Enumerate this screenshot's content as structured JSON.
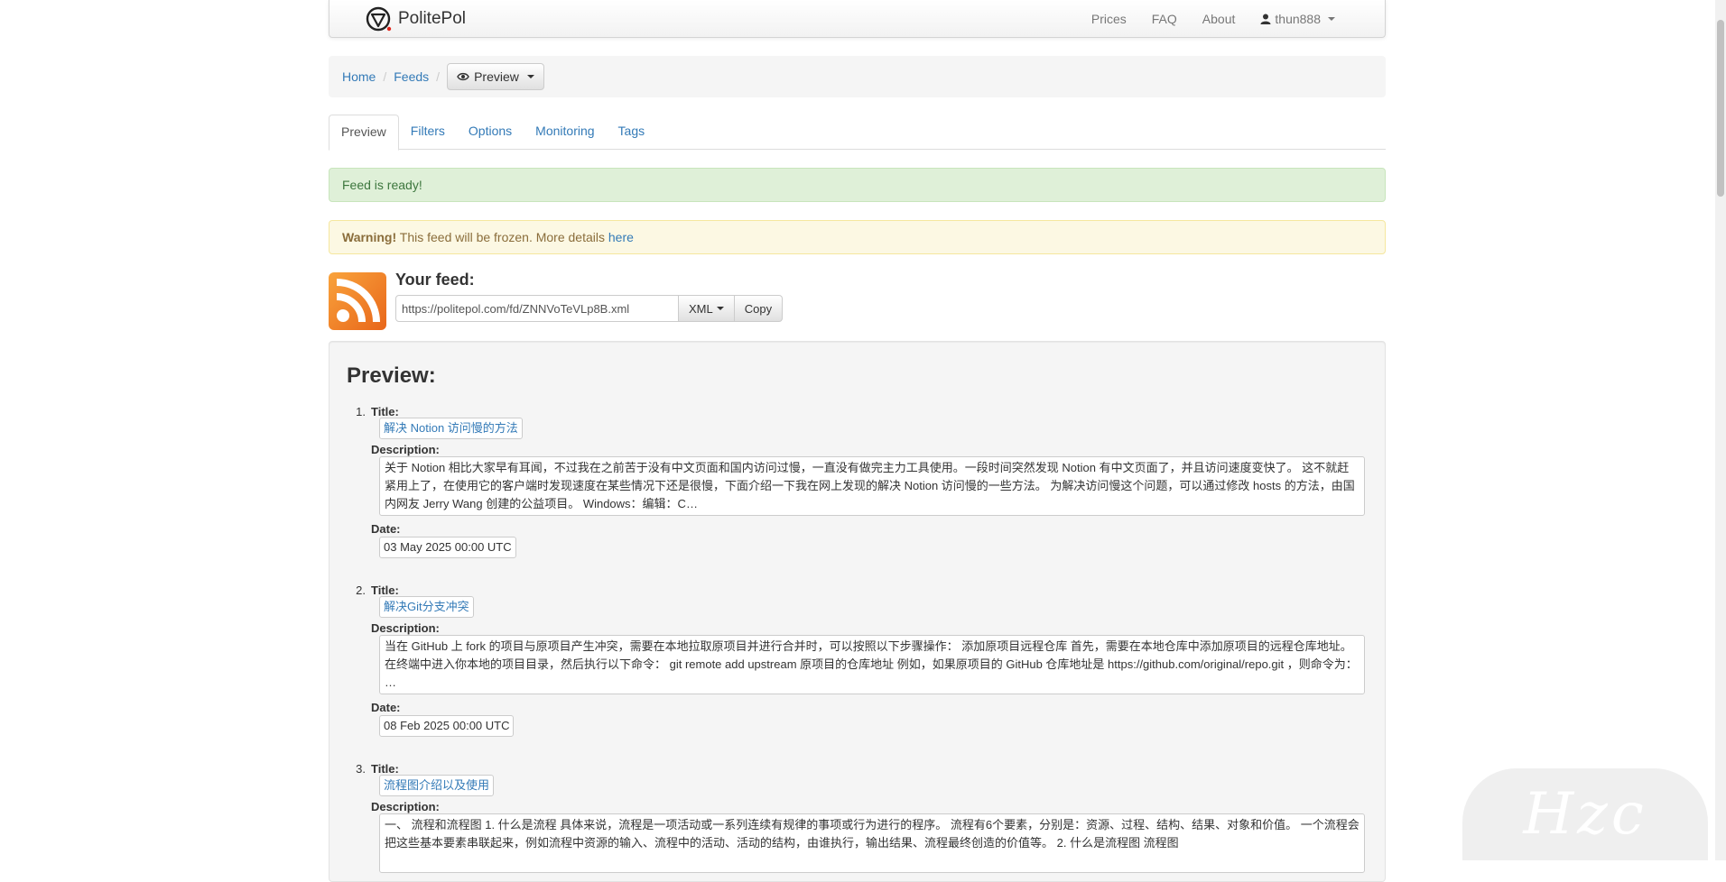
{
  "navbar": {
    "brand": "PolitePol",
    "links": [
      "Prices",
      "FAQ",
      "About"
    ],
    "user": "thun888"
  },
  "breadcrumb": {
    "home": "Home",
    "feeds": "Feeds",
    "preview_button": "Preview"
  },
  "tabs": [
    "Preview",
    "Filters",
    "Options",
    "Monitoring",
    "Tags"
  ],
  "alerts": {
    "success": "Feed is ready!",
    "warning_strong": "Warning!",
    "warning_text": " This feed will be frozen. More details ",
    "warning_link": "here"
  },
  "feed": {
    "label": "Your feed:",
    "url": "https://politepol.com/fd/ZNNVoTeVLp8B.xml",
    "format": "XML",
    "copy": "Copy"
  },
  "preview": {
    "heading": "Preview:",
    "labels": {
      "title": "Title:",
      "description": "Description:",
      "date": "Date:"
    },
    "items": [
      {
        "num": "1.",
        "title": "解决 Notion 访问慢的方法",
        "description": "关于 Notion 相比大家早有耳闻，不过我在之前苦于没有中文页面和国内访问过慢，一直没有做完主力工具使用。一段时间突然发现 Notion 有中文页面了，并且访问速度变快了。 这不就赶紧用上了，在使用它的客户端时发现速度在某些情况下还是很慢，下面介绍一下我在网上发现的解决 Notion 访问慢的一些方法。 为解决访问慢这个问题，可以通过修改 hosts 的方法，由国内网友 Jerry Wang 创建的公益项目。 Windows：编辑：C…",
        "date": "03 May 2025 00:00 UTC"
      },
      {
        "num": "2.",
        "title": "解决Git分支冲突",
        "description": "当在 GitHub 上 fork 的项目与原项目产生冲突，需要在本地拉取原项目并进行合并时，可以按照以下步骤操作： 添加原项目远程仓库 首先，需要在本地仓库中添加原项目的远程仓库地址。在终端中进入你本地的项目目录，然后执行以下命令： git remote add upstream 原项目的仓库地址 例如，如果原项目的 GitHub 仓库地址是 https://github.com/original/repo.git ，则命令为： …",
        "date": "08 Feb 2025 00:00 UTC"
      },
      {
        "num": "3.",
        "title": "流程图介绍以及使用",
        "description": "一、 流程和流程图 1. 什么是流程 具体来说，流程是一项活动或一系列连续有规律的事项或行为进行的程序。 流程有6个要素，分别是：资源、过程、结构、结果、对象和价值。 一个流程会把这些基本要素串联起来，例如流程中资源的输入、流程中的活动、活动的结构，由谁执行，输出结果、流程最终创造的价值等。 2. 什么是流程图 流程图",
        "date": ""
      }
    ]
  },
  "watermark": "Hzc"
}
